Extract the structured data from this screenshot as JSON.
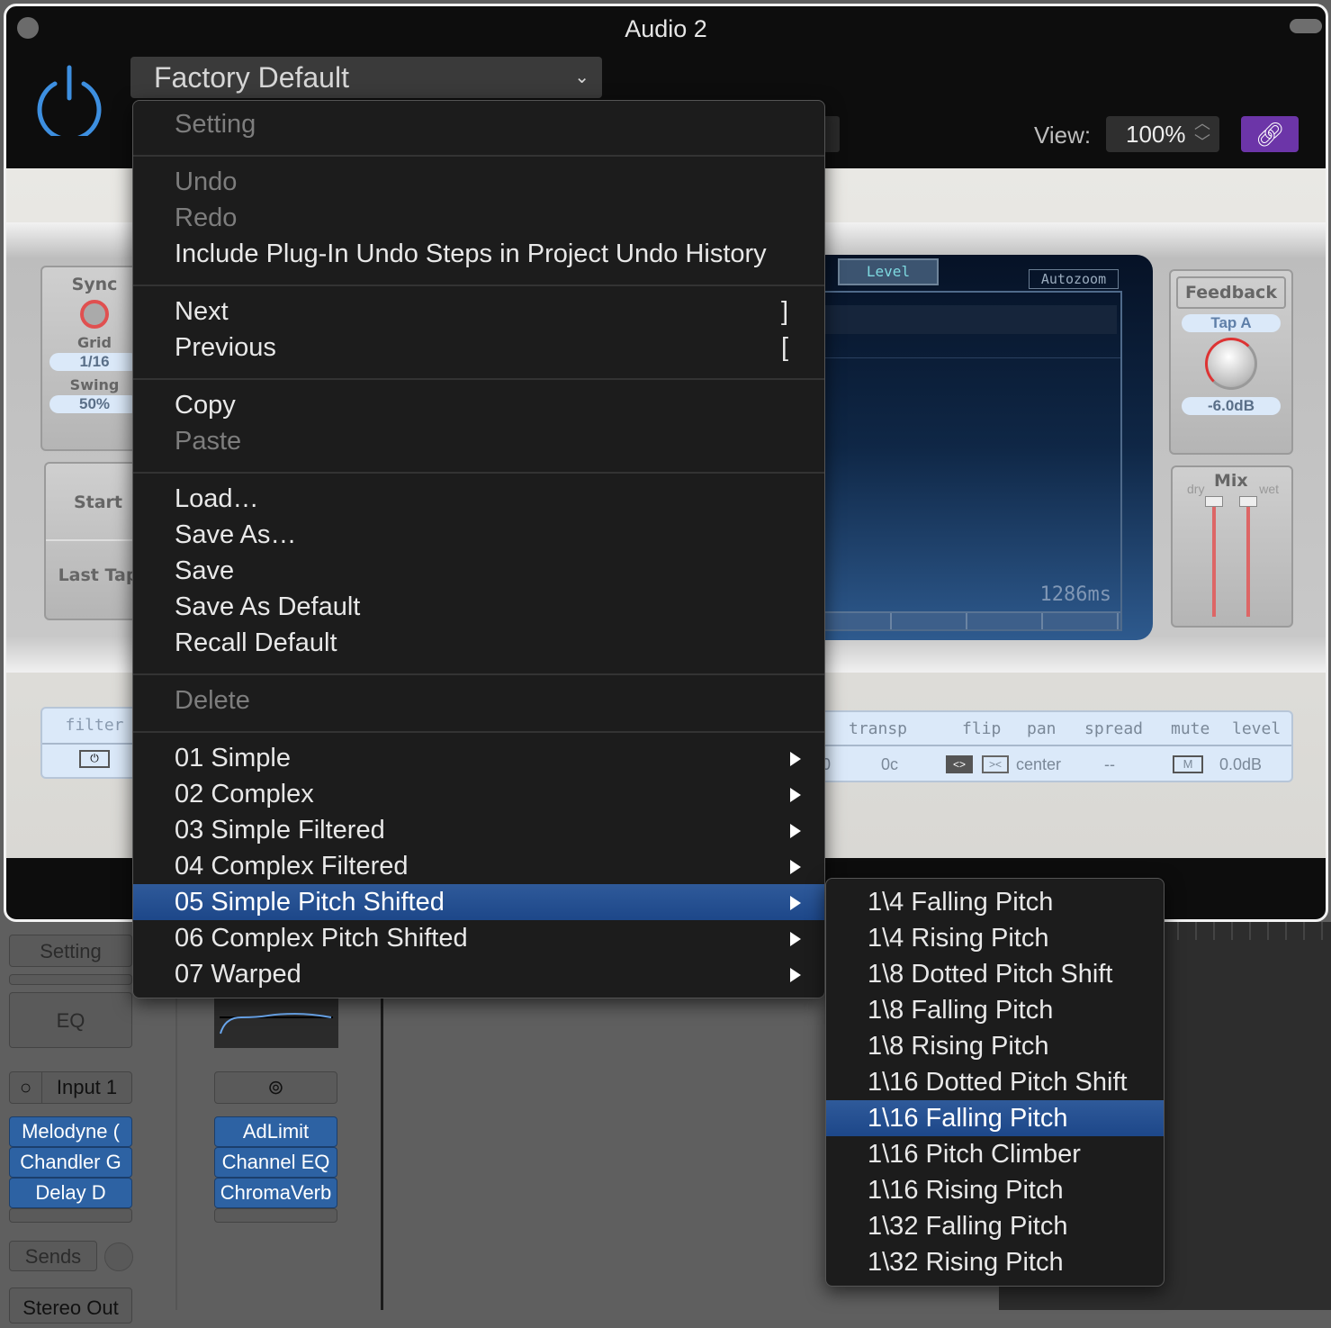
{
  "window": {
    "title": "Audio 2"
  },
  "header": {
    "preset": "Factory Default",
    "view_label": "View:",
    "view_value": "100%"
  },
  "colors": {
    "accent_power": "#3d8fe0",
    "link_button": "#6c35a8",
    "highlight": "#1f4a8c"
  },
  "plugin": {
    "sync": "Sync",
    "grid": "Grid",
    "grid_value": "1/16",
    "swing": "Swing",
    "swing_value": "50%",
    "start": "Start",
    "last_tap": "Last Tap",
    "filter": "filter",
    "level_tab": "Level",
    "autozoom": "Autozoom",
    "time": "1286ms",
    "feedback": "Feedback",
    "tap": "Tap A",
    "feedback_value": "-6.0dB",
    "mix": "Mix",
    "dry": "dry",
    "wet": "wet",
    "transp": "transp",
    "flip": "flip",
    "pan": "pan",
    "spread": "spread",
    "mute": "mute",
    "level": "level",
    "transp_val1": "0",
    "transp_val2": "0c",
    "pan_val": "center",
    "spread_val": "--",
    "mute_btn": "M",
    "level_val": "0.0dB"
  },
  "menu": {
    "items": [
      {
        "label": "Setting",
        "disabled": true
      },
      {
        "sep": true
      },
      {
        "label": "Undo",
        "disabled": true
      },
      {
        "label": "Redo",
        "disabled": true
      },
      {
        "label": "Include Plug-In Undo Steps in Project Undo History"
      },
      {
        "sep": true
      },
      {
        "label": "Next",
        "shortcut": "]"
      },
      {
        "label": "Previous",
        "shortcut": "["
      },
      {
        "sep": true
      },
      {
        "label": "Copy"
      },
      {
        "label": "Paste",
        "disabled": true
      },
      {
        "sep": true
      },
      {
        "label": "Load…"
      },
      {
        "label": "Save As…"
      },
      {
        "label": "Save"
      },
      {
        "label": "Save As Default"
      },
      {
        "label": "Recall Default"
      },
      {
        "sep": true
      },
      {
        "label": "Delete",
        "disabled": true
      },
      {
        "sep": true
      },
      {
        "label": "01 Simple",
        "submenu": true
      },
      {
        "label": "02 Complex",
        "submenu": true
      },
      {
        "label": "03 Simple Filtered",
        "submenu": true
      },
      {
        "label": "04 Complex Filtered",
        "submenu": true
      },
      {
        "label": "05 Simple Pitch Shifted",
        "submenu": true,
        "highlighted": true
      },
      {
        "label": "06 Complex Pitch Shifted",
        "submenu": true
      },
      {
        "label": "07 Warped",
        "submenu": true
      }
    ]
  },
  "submenu": {
    "items": [
      {
        "label": "1\\4 Falling Pitch"
      },
      {
        "label": "1\\4 Rising Pitch"
      },
      {
        "label": "1\\8 Dotted Pitch Shift"
      },
      {
        "label": "1\\8 Falling Pitch"
      },
      {
        "label": "1\\8 Rising Pitch"
      },
      {
        "label": "1\\16 Dotted Pitch Shift"
      },
      {
        "label": "1\\16 Falling Pitch",
        "highlighted": true
      },
      {
        "label": "1\\16 Pitch Climber"
      },
      {
        "label": "1\\16 Rising Pitch"
      },
      {
        "label": "1\\32 Falling Pitch"
      },
      {
        "label": "1\\32 Rising Pitch"
      }
    ]
  },
  "mixer": {
    "setting": "Setting",
    "eq": "EQ",
    "input": "Input 1",
    "sends": "Sends",
    "output": "Stereo Out",
    "plugins_a": [
      "Melodyne (",
      "Chandler G",
      "Delay D"
    ],
    "plugins_b": [
      "AdLimit",
      "Channel EQ",
      "ChromaVerb"
    ]
  }
}
